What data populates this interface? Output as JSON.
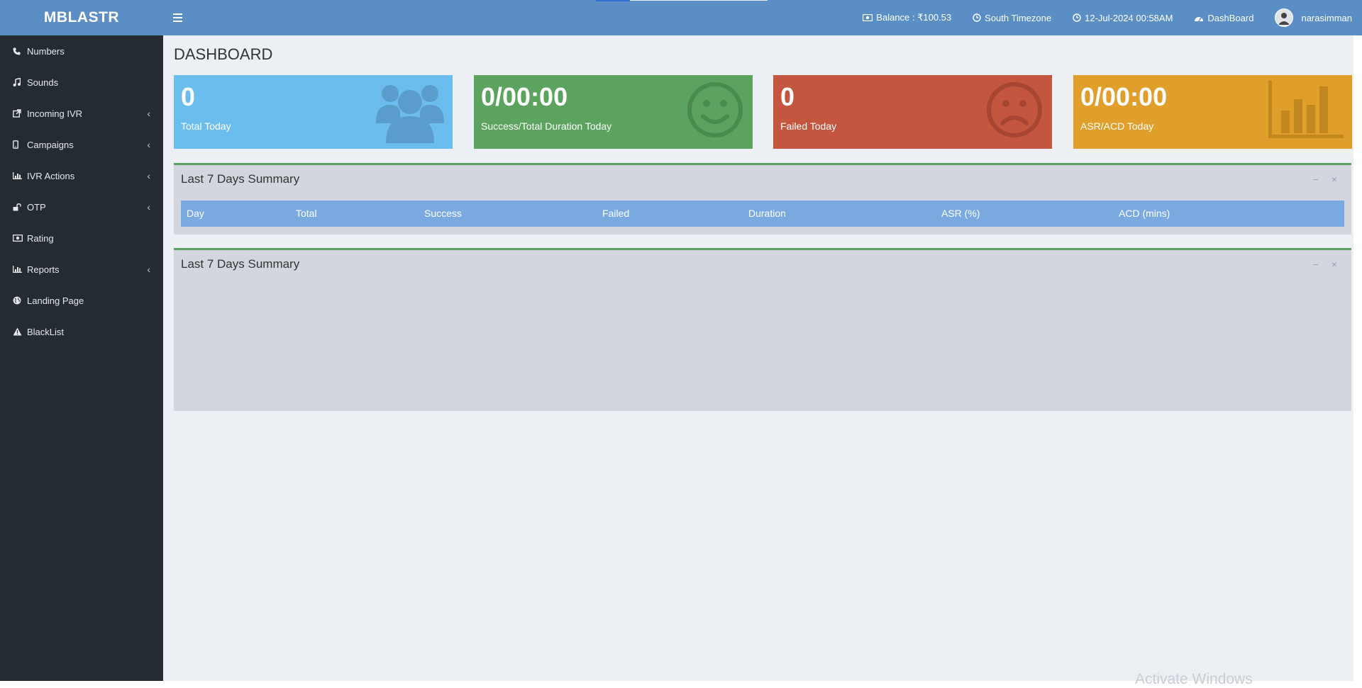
{
  "app": {
    "brand": "MBLASTR"
  },
  "header": {
    "balance": "Balance : ₹100.53",
    "timezone": "South Timezone",
    "datetime": "12-Jul-2024 00:58AM",
    "dashboard_link": "DashBoard",
    "username": "narasimman"
  },
  "sidebar": {
    "items": [
      {
        "label": "Numbers",
        "icon": "phone-icon",
        "has_submenu": false
      },
      {
        "label": "Sounds",
        "icon": "music-icon",
        "has_submenu": false
      },
      {
        "label": "Incoming IVR",
        "icon": "external-link-icon",
        "has_submenu": true
      },
      {
        "label": "Campaigns",
        "icon": "mobile-icon",
        "has_submenu": true
      },
      {
        "label": "IVR Actions",
        "icon": "bar-chart-icon",
        "has_submenu": true
      },
      {
        "label": "OTP",
        "icon": "unlock-icon",
        "has_submenu": true
      },
      {
        "label": "Rating",
        "icon": "money-icon",
        "has_submenu": false
      },
      {
        "label": "Reports",
        "icon": "bar-chart-icon",
        "has_submenu": true
      },
      {
        "label": "Landing Page",
        "icon": "globe-icon",
        "has_submenu": false
      },
      {
        "label": "BlackList",
        "icon": "warning-icon",
        "has_submenu": false
      }
    ],
    "chevron": "‹"
  },
  "page": {
    "title": "DASHBOARD"
  },
  "stats": [
    {
      "value": "0",
      "label": "Total Today",
      "color": "#6bbdee",
      "icon": "users-icon"
    },
    {
      "value": "0/00:00",
      "label": "Success/Total Duration Today",
      "color": "#5ba35e",
      "icon": "smile-icon"
    },
    {
      "value": "0",
      "label": "Failed Today",
      "color": "#c4553e",
      "icon": "frown-icon"
    },
    {
      "value": "0/00:00",
      "label": "ASR/ACD Today",
      "color": "#e09e2a",
      "icon": "bar-chart-icon"
    }
  ],
  "panels": [
    {
      "title": "Last 7 Days Summary",
      "columns": [
        "Day",
        "Total",
        "Success",
        "Failed",
        "Duration",
        "ASR (%)",
        "ACD (mins)"
      ]
    },
    {
      "title": "Last 7 Days Summary"
    }
  ],
  "tools": {
    "minimize": "−",
    "close": "×"
  },
  "watermark": "Activate Windows",
  "colors": {
    "header": "#5b8ec4",
    "sidebar": "#242b31",
    "content_bg": "#ecf0f5",
    "table_header": "#7aa9df",
    "panel_border": "#5ba35e"
  }
}
